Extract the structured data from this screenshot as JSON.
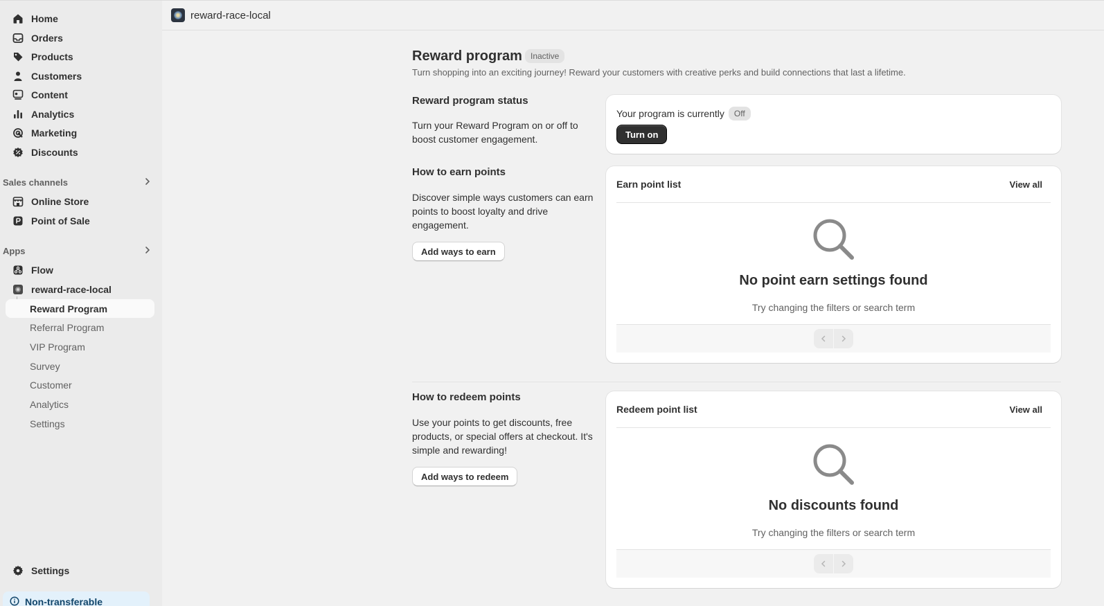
{
  "sidebar": {
    "items": [
      {
        "label": "Home",
        "icon": "home-icon"
      },
      {
        "label": "Orders",
        "icon": "inbox-icon"
      },
      {
        "label": "Products",
        "icon": "tag-icon"
      },
      {
        "label": "Customers",
        "icon": "person-icon"
      },
      {
        "label": "Content",
        "icon": "content-icon"
      },
      {
        "label": "Analytics",
        "icon": "bar-chart-icon"
      },
      {
        "label": "Marketing",
        "icon": "target-icon"
      },
      {
        "label": "Discounts",
        "icon": "discount-icon"
      }
    ],
    "sales_channels": {
      "label": "Sales channels",
      "items": [
        {
          "label": "Online Store",
          "icon": "store-icon"
        },
        {
          "label": "Point of Sale",
          "icon": "pos-icon"
        }
      ]
    },
    "apps": {
      "label": "Apps",
      "items": [
        {
          "label": "Flow",
          "icon": "flow-icon"
        },
        {
          "label": "reward-race-local",
          "icon": "app-icon"
        }
      ],
      "sub_items": [
        {
          "label": "Reward Program",
          "active": true
        },
        {
          "label": "Referral Program"
        },
        {
          "label": "VIP Program"
        },
        {
          "label": "Survey"
        },
        {
          "label": "Customer"
        },
        {
          "label": "Analytics"
        },
        {
          "label": "Settings"
        }
      ]
    },
    "settings": {
      "label": "Settings",
      "icon": "gear-icon"
    },
    "banner": {
      "label": "Non-transferable",
      "icon": "info-icon"
    }
  },
  "topbar": {
    "app_name": "reward-race-local"
  },
  "page": {
    "title": "Reward program",
    "status_badge": "Inactive",
    "subtitle": "Turn shopping into an exciting journey! Reward your customers with creative perks and build connections that last a lifetime."
  },
  "status_section": {
    "title": "Reward program status",
    "description": "Turn your Reward Program on or off to boost customer engagement.",
    "card_text": "Your program is currently",
    "state_badge": "Off",
    "button": "Turn on"
  },
  "earn_section": {
    "title": "How to earn points",
    "description": "Discover simple ways customers can earn points to boost loyalty and drive engagement.",
    "button": "Add ways to earn",
    "card_title": "Earn point list",
    "view_all": "View all",
    "empty_title": "No point earn settings found",
    "empty_sub": "Try changing the filters or search term"
  },
  "redeem_section": {
    "title": "How to redeem points",
    "description": "Use your points to get discounts, free products, or special offers at checkout. It's simple and rewarding!",
    "button": "Add ways to redeem",
    "card_title": "Redeem point list",
    "view_all": "View all",
    "empty_title": "No discounts found",
    "empty_sub": "Try changing the filters or search term"
  },
  "colors": {
    "sidebar_bg": "#ebebeb",
    "page_bg": "#f1f1f1",
    "primary_button": "#303030",
    "banner_bg": "#e3f1fb"
  }
}
